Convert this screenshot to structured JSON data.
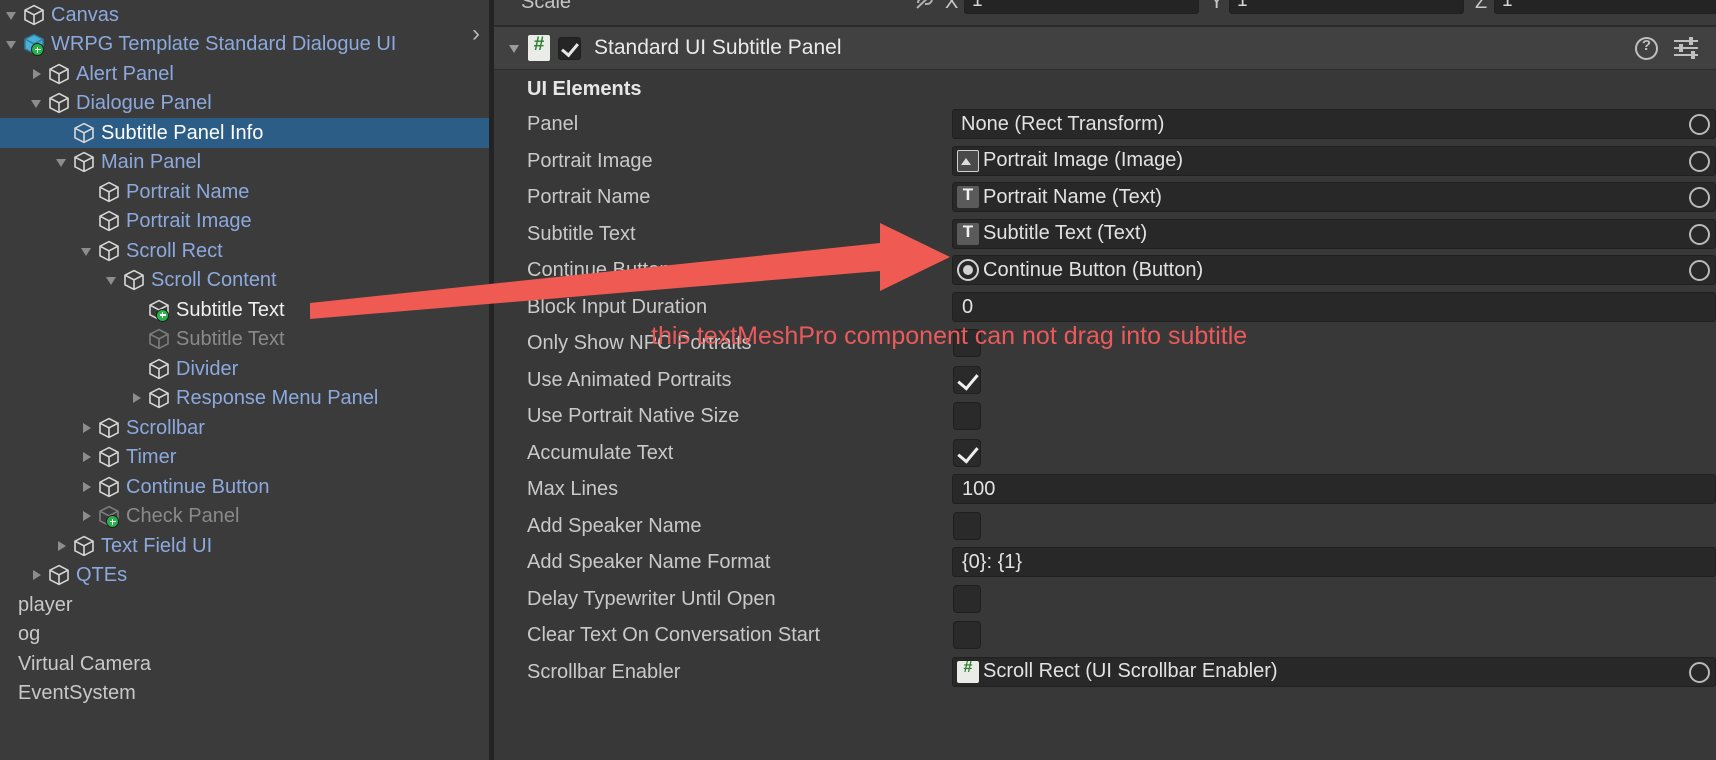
{
  "hierarchy": {
    "rows": [
      {
        "label": "Canvas",
        "indent": 0,
        "twisty": "down",
        "icon": "cube",
        "style": "link",
        "partial": true
      },
      {
        "label": "WRPG Template Standard Dialogue UI",
        "indent": 0,
        "twisty": "down",
        "icon": "prefab-variant",
        "style": "link"
      },
      {
        "label": "Alert Panel",
        "indent": 1,
        "twisty": "right",
        "icon": "cube",
        "style": "link"
      },
      {
        "label": "Dialogue Panel",
        "indent": 1,
        "twisty": "down",
        "icon": "cube",
        "style": "link"
      },
      {
        "label": "Subtitle Panel Info",
        "indent": 2,
        "twisty": "none",
        "icon": "cube",
        "style": "selected"
      },
      {
        "label": "Main Panel",
        "indent": 2,
        "twisty": "down",
        "icon": "cube",
        "style": "link"
      },
      {
        "label": "Portrait Name",
        "indent": 3,
        "twisty": "none",
        "icon": "cube",
        "style": "link"
      },
      {
        "label": "Portrait Image",
        "indent": 3,
        "twisty": "none",
        "icon": "cube",
        "style": "link"
      },
      {
        "label": "Scroll Rect",
        "indent": 3,
        "twisty": "down",
        "icon": "cube",
        "style": "link"
      },
      {
        "label": "Scroll Content",
        "indent": 4,
        "twisty": "down",
        "icon": "cube",
        "style": "link"
      },
      {
        "label": "Subtitle Text",
        "indent": 5,
        "twisty": "none",
        "icon": "prefab-add",
        "style": "white"
      },
      {
        "label": "Subtitle Text",
        "indent": 5,
        "twisty": "none",
        "icon": "cube",
        "style": "dim"
      },
      {
        "label": "Divider",
        "indent": 5,
        "twisty": "none",
        "icon": "cube",
        "style": "link"
      },
      {
        "label": "Response Menu Panel",
        "indent": 5,
        "twisty": "right",
        "icon": "cube",
        "style": "link"
      },
      {
        "label": "Scrollbar",
        "indent": 3,
        "twisty": "right",
        "icon": "cube",
        "style": "link"
      },
      {
        "label": "Timer",
        "indent": 3,
        "twisty": "right",
        "icon": "cube",
        "style": "link"
      },
      {
        "label": "Continue Button",
        "indent": 3,
        "twisty": "right",
        "icon": "cube",
        "style": "link"
      },
      {
        "label": "Check Panel",
        "indent": 3,
        "twisty": "right",
        "icon": "prefab-add-dim",
        "style": "dim"
      },
      {
        "label": "Text Field UI",
        "indent": 2,
        "twisty": "right",
        "icon": "cube",
        "style": "link"
      },
      {
        "label": "QTEs",
        "indent": 1,
        "twisty": "right",
        "icon": "cube",
        "style": "link"
      },
      {
        "label": "player",
        "indent": -1,
        "twisty": "none",
        "icon": "none",
        "style": "plain"
      },
      {
        "label": "og",
        "indent": -1,
        "twisty": "none",
        "icon": "none",
        "style": "plain"
      },
      {
        "label": "Virtual Camera",
        "indent": -1,
        "twisty": "none",
        "icon": "none",
        "style": "plain"
      },
      {
        "label": "EventSystem",
        "indent": -1,
        "twisty": "none",
        "icon": "none",
        "style": "plain"
      }
    ],
    "expand_chevron": "›"
  },
  "inspector": {
    "transform_partial": {
      "label": "Scale",
      "lock_icon": "link-lock-icon",
      "axes": [
        {
          "name": "X",
          "value": "1"
        },
        {
          "name": "Y",
          "value": "1"
        },
        {
          "name": "Z",
          "value": "1"
        }
      ]
    },
    "component": {
      "title": "Standard UI Subtitle Panel",
      "enabled": true,
      "script_icon": "#",
      "help_icon": "help-icon",
      "preset_icon": "preset-icon"
    },
    "section_title": "UI Elements",
    "properties": [
      {
        "label": "Panel",
        "type": "object",
        "icon": "none",
        "value": "None (Rect Transform)"
      },
      {
        "label": "Portrait Image",
        "type": "object",
        "icon": "image",
        "value": "Portrait Image (Image)"
      },
      {
        "label": "Portrait Name",
        "type": "object",
        "icon": "text",
        "value": "Portrait Name (Text)"
      },
      {
        "label": "Subtitle Text",
        "type": "object",
        "icon": "text",
        "value": "Subtitle Text (Text)"
      },
      {
        "label": "Continue Button",
        "type": "object",
        "icon": "button",
        "value": "Continue Button (Button)"
      },
      {
        "label": "Block Input Duration",
        "type": "number",
        "value": "0"
      },
      {
        "label": "Only Show NPC Portraits",
        "type": "checkbox",
        "checked": false
      },
      {
        "label": "Use Animated Portraits",
        "type": "checkbox",
        "checked": true
      },
      {
        "label": "Use Portrait Native Size",
        "type": "checkbox",
        "checked": false
      },
      {
        "label": "Accumulate Text",
        "type": "checkbox",
        "checked": true
      },
      {
        "label": "Max Lines",
        "type": "number",
        "value": "100"
      },
      {
        "label": "Add Speaker Name",
        "type": "checkbox",
        "checked": false
      },
      {
        "label": "Add Speaker Name Format",
        "type": "number",
        "value": "{0}: {1}"
      },
      {
        "label": "Delay Typewriter Until Open",
        "type": "checkbox",
        "checked": false
      },
      {
        "label": "Clear Text On Conversation Start",
        "type": "checkbox",
        "checked": false
      },
      {
        "label": "Scrollbar Enabler",
        "type": "object",
        "icon": "script",
        "value": "Scroll Rect (UI Scrollbar Enabler)"
      }
    ]
  },
  "annotation": {
    "text": "this textMeshPro component can not drag into subtitle",
    "color": "#ea5a5a",
    "arrow": "arrow-from-hierarchy-to-subtitle-text-field"
  }
}
